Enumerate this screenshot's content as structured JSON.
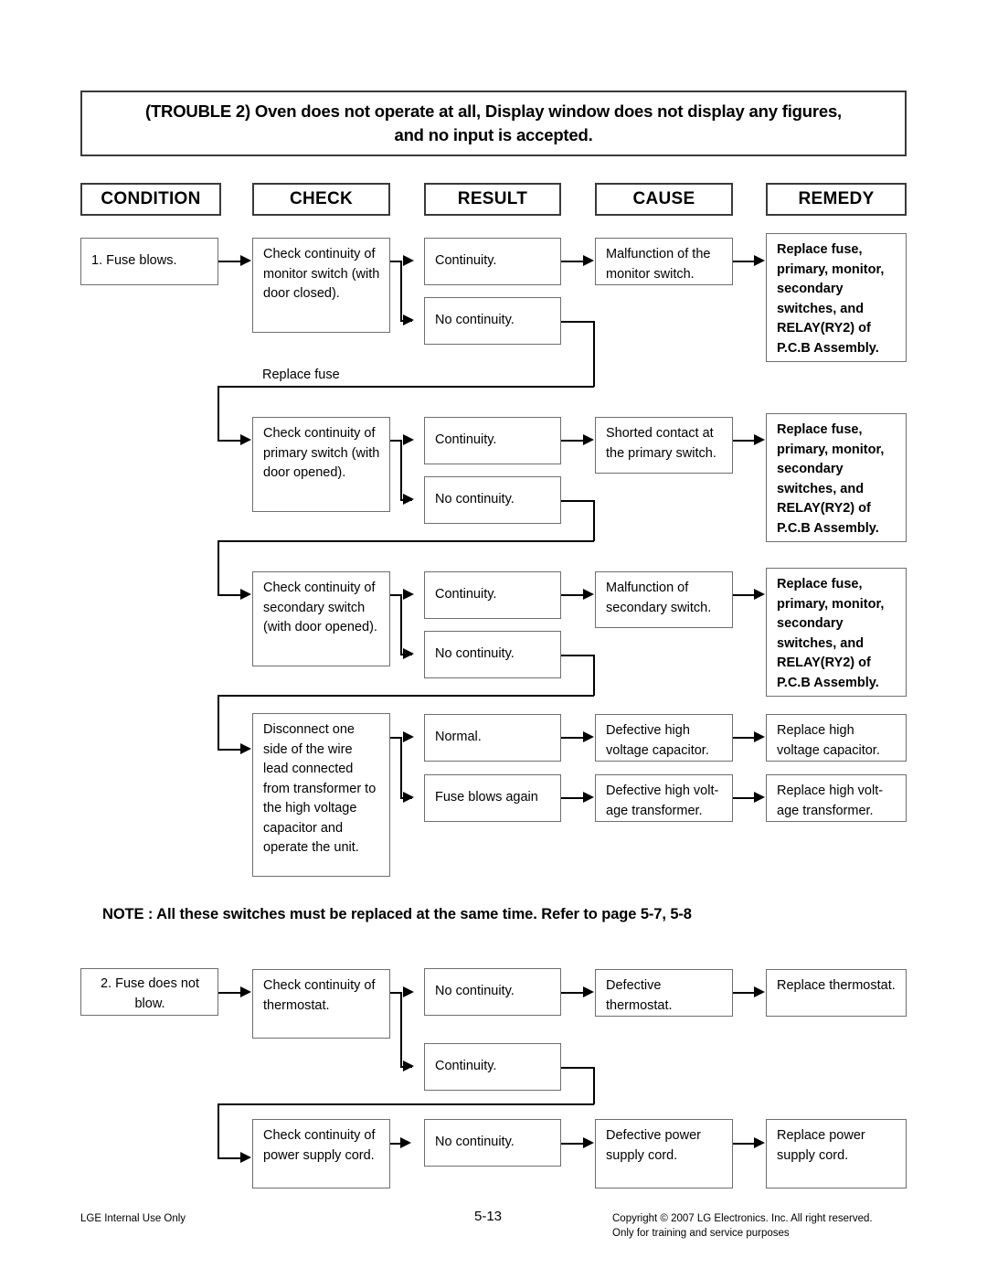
{
  "page": {
    "title_line1": "(TROUBLE 2) Oven does not operate at all, Display window does not display any figures,",
    "title_line2": "and no input is accepted.",
    "note": "NOTE : All these switches must be replaced at the same time. Refer to page 5-7, 5-8",
    "loose_label_replace_fuse": "Replace fuse"
  },
  "columns": {
    "condition": "CONDITION",
    "check": "CHECK",
    "result": "RESULT",
    "cause": "CAUSE",
    "remedy": "REMEDY"
  },
  "section1": {
    "condition": "1. Fuse blows.",
    "rows": [
      {
        "check": "Check continuity of monitor switch (with door closed).",
        "result_a": "Continuity.",
        "result_b": "No continuity.",
        "cause": "Malfunction of the monitor switch.",
        "remedy": "Replace fuse, primary, monitor, secondary switches, and RELAY(RY2) of P.C.B Assembly."
      },
      {
        "check": "Check continuity of primary switch (with door opened).",
        "result_a": "Continuity.",
        "result_b": "No continuity.",
        "cause": "Shorted contact at the primary switch.",
        "remedy": "Replace fuse, primary, monitor, secondary switches, and RELAY(RY2) of P.C.B Assembly."
      },
      {
        "check": "Check continuity of secondary switch (with door opened).",
        "result_a": "Continuity.",
        "result_b": "No continuity.",
        "cause": "Malfunction of secondary switch.",
        "remedy": "Replace fuse, primary, monitor, secondary switches, and RELAY(RY2) of P.C.B Assembly."
      }
    ],
    "transformer_row": {
      "check": "Disconnect one side of the wire lead connected from transformer to the high voltage capacitor and operate the unit.",
      "result_a": "Normal.",
      "cause_a": "Defective high voltage capacitor.",
      "remedy_a": "Replace high voltage capacitor.",
      "result_b": "Fuse blows again",
      "cause_b": "Defective high volt-age transformer.",
      "remedy_b": "Replace high volt-age transformer."
    }
  },
  "section2": {
    "condition": "2. Fuse does not blow.",
    "rows": [
      {
        "check": "Check continuity of thermostat.",
        "result_a": "No continuity.",
        "result_b": "Continuity.",
        "cause": "Defective thermostat.",
        "remedy": "Replace thermostat."
      },
      {
        "check": "Check continuity of power supply cord.",
        "result_a": "No continuity.",
        "cause": "Defective power supply cord.",
        "remedy": "Replace power supply cord."
      }
    ]
  },
  "footer": {
    "left": "LGE Internal Use Only",
    "page": "5-13",
    "right_line1": "Copyright © 2007 LG Electronics. Inc. All right reserved.",
    "right_line2": "Only for training and service purposes"
  }
}
